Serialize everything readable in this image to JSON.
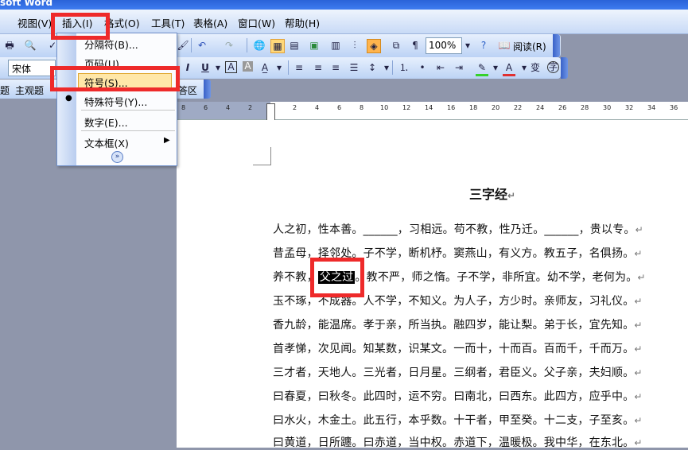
{
  "app": {
    "title_fragment": "soft Word"
  },
  "menubar": {
    "items": [
      "视图(V)",
      "插入(I)",
      "格式(O)",
      "工具(T)",
      "表格(A)",
      "窗口(W)",
      "帮助(H)"
    ]
  },
  "insert_menu": {
    "items": [
      {
        "label": "分隔符(B)..."
      },
      {
        "label": "页码(U)..."
      },
      {
        "label": "符号(S)..."
      },
      {
        "label": "特殊符号(Y)..."
      },
      {
        "label": "数字(E)..."
      },
      {
        "label": "文本框(X)"
      }
    ]
  },
  "toolbar": {
    "zoom": "100%",
    "read_label": "阅读(R)",
    "font_name": "宋体",
    "tb3_labels": [
      "题",
      "主观题",
      "答区"
    ]
  },
  "ruler": {
    "left_numbers": [
      "8",
      "6",
      "4",
      "2"
    ],
    "right_numbers": [
      "2",
      "4",
      "6",
      "8",
      "10",
      "12",
      "14",
      "16",
      "18",
      "20",
      "22",
      "24",
      "26",
      "28",
      "30",
      "32",
      "34",
      "36"
    ]
  },
  "document": {
    "title": "三字经",
    "lines": [
      "人之初，性本善。______，习相远。苟不教，性乃迁。______，贵以专。",
      "昔孟母，择邻处。子不学，断机杼。窦燕山，有义方。教五子，名俱扬。",
      "养不教，",
      "玉不琢，不成器。人不学，不知义。为人子，方少时。亲师友，习礼仪。",
      "香九龄，能温席。孝于亲，所当执。融四岁，能让梨。弟于长，宜先知。",
      "首孝悌，次见闻。知某数，识某文。一而十，十而百。百而千，千而万。",
      "三才者，天地人。三光者，日月星。三纲者，君臣义。父子亲，夫妇顺。",
      "曰春夏，曰秋冬。此四时，运不穷。曰南北，曰西东。此四方，应乎中。",
      "曰水火，木金土。此五行，本乎数。十干者，甲至癸。十二支，子至亥。",
      "曰黄道，日所躔。曰赤道，当中权。赤道下，温暖极。我中华，在东北。"
    ],
    "line3_highlight": "父之过",
    "line3_rest": "。教不严，师之惰。子不学，非所宜。幼不学，老何为。"
  }
}
